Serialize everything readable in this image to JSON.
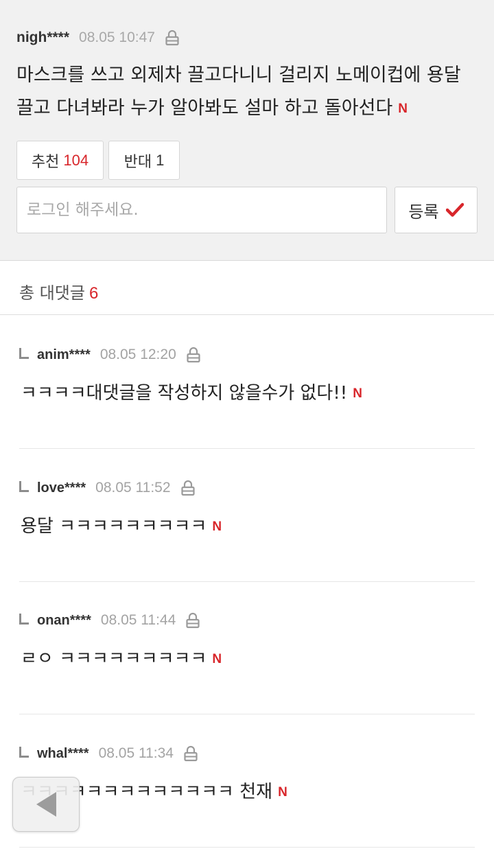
{
  "comment": {
    "user": "nigh****",
    "time": "08.05 10:47",
    "text": "마스크를 쓰고 외제차 끌고다니니 걸리지 노메이컵에 용달 끌고 다녀봐라 누가 알아봐도 설마 하고 돌아선다",
    "new_badge": "N",
    "recommend_label": "추천",
    "recommend_count": "104",
    "oppose_label": "반대",
    "oppose_count": "1"
  },
  "reply_form": {
    "placeholder": "로그인 해주세요.",
    "submit_label": "등록"
  },
  "replies_header": {
    "label": "총 대댓글",
    "count": "6"
  },
  "replies": [
    {
      "user": "anim****",
      "time": "08.05 12:20",
      "text": "ㅋㅋㅋㅋ대댓글을 작성하지 않을수가 없다!!",
      "badge": "N"
    },
    {
      "user": "love****",
      "time": "08.05 11:52",
      "text": "용달 ㅋㅋㅋㅋㅋㅋㅋㅋㅋ",
      "badge": "N"
    },
    {
      "user": "onan****",
      "time": "08.05 11:44",
      "text": "ㄹㅇ ㅋㅋㅋㅋㅋㅋㅋㅋㅋ",
      "badge": "N"
    },
    {
      "user": "whal****",
      "time": "08.05 11:34",
      "text": "ㅋㅋㅋㅋㅋㅋㅋㅋㅋㅋㅋㅋㅋ 천재",
      "badge": "N"
    }
  ],
  "colors": {
    "accent_red": "#d8262b",
    "panel_bg": "#f1f1f1",
    "muted_text": "#a8a8a8"
  },
  "icons": {
    "lock": "lock-icon",
    "check": "check-icon",
    "reply_arrow": "reply-elbow-icon",
    "back": "back-triangle-icon"
  }
}
